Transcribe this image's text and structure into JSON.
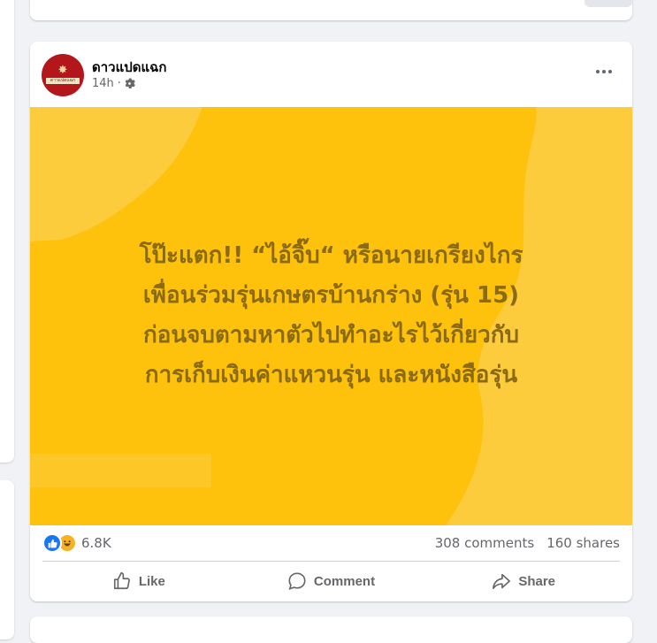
{
  "post": {
    "page_name": "ดาวแปดแฉก",
    "avatar_logo_text": "ดาวแปดแฉก",
    "time": "14h",
    "separator": "·",
    "visibility_icon": "gear-icon",
    "more_icon": "more-dots-icon",
    "image_text": "โป๊ะแตก!! “ไอ้จิ๊บ“ หรือนายเกรียงไกร\nเพื่อนร่วมรุ่นเกษตรบ้านกร่าง (รุ่น 15)\nก่อนจบตามหาตัวไปทำอะไรไว้เกี่ยวกับ\nการเก็บเงินค่าแหวนรุ่น และหนังสือรุ่น",
    "image_bg_color": "#fec10c",
    "image_text_color": "#8a6a13",
    "reactions": {
      "icons": [
        "like-reaction-icon",
        "haha-reaction-icon"
      ],
      "count": "6.8K"
    },
    "comments": "308 comments",
    "shares": "160 shares",
    "actions": {
      "like": "Like",
      "comment": "Comment",
      "share": "Share"
    }
  }
}
